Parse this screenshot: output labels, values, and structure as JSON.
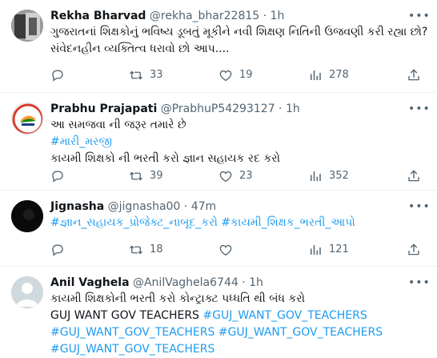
{
  "colors": {
    "accent": "#1d9bf0",
    "text": "#0f1419",
    "muted": "#536471",
    "divider": "#eff3f4"
  },
  "tweets": [
    {
      "name": "Rekha Bharvad",
      "handle": "@rekha_bhar22815",
      "dot": "·",
      "time": "1h",
      "lines": [
        "ગુજરાતનાં શિક્ષકોનું ભવિષ્ય ડૂબતું મૂકીને નવી શિક્ષણ નિતિની ઉજવણી કરી રહ્યા છો?",
        "સંવેદનહીન વ્યક્તિત્વ ધરાવો છો આપ...."
      ],
      "replies": "",
      "retweets": "33",
      "likes": "19",
      "views": "278",
      "more_icon": "more-icon"
    },
    {
      "name": "Prabhu Prajapati",
      "handle": "@PrabhuP54293127",
      "dot": "·",
      "time": "1h",
      "lines": [
        "આ સમજવા ની જરૂર તમારે છે",
        "#મારી_મરજી",
        "કાયમી શિક્ષકો ની ભરતી કરો જ્ઞાન સહાયક રદ કરો"
      ],
      "replies": "",
      "retweets": "39",
      "likes": "23",
      "views": "352"
    },
    {
      "name": "Jignasha",
      "handle": "@jignasha00",
      "dot": "·",
      "time": "47m",
      "lines": [
        "#જ્ઞાન_સહાયક_પ્રોજેક્ટ_નાબૂદ_કરો #કાયમી_શિક્ષક_ભરતી_આપો"
      ],
      "replies": "",
      "retweets": "18",
      "likes": "",
      "views": "121"
    },
    {
      "name": "Anil Vaghela",
      "handle": "@AnilVaghela6744",
      "dot": "·",
      "time": "1h",
      "lines": [
        "કાયમી શિક્ષકોની ભરતી કરો કોન્ટ્રાક્ટ પધ્ધતિ થી બંધ કરો",
        "GUJ WANT GOV TEACHERS",
        "#GUJ_WANT_GOV_TEACHERS",
        "#GUJ_WANT_GOV_TEACHERS",
        "#GUJ_WANT_GOV_TEACHERS",
        "#GUJ_WANT_GOV_TEACHERS",
        "#GUJ_WANT_GOV_TEACHERS"
      ]
    }
  ]
}
